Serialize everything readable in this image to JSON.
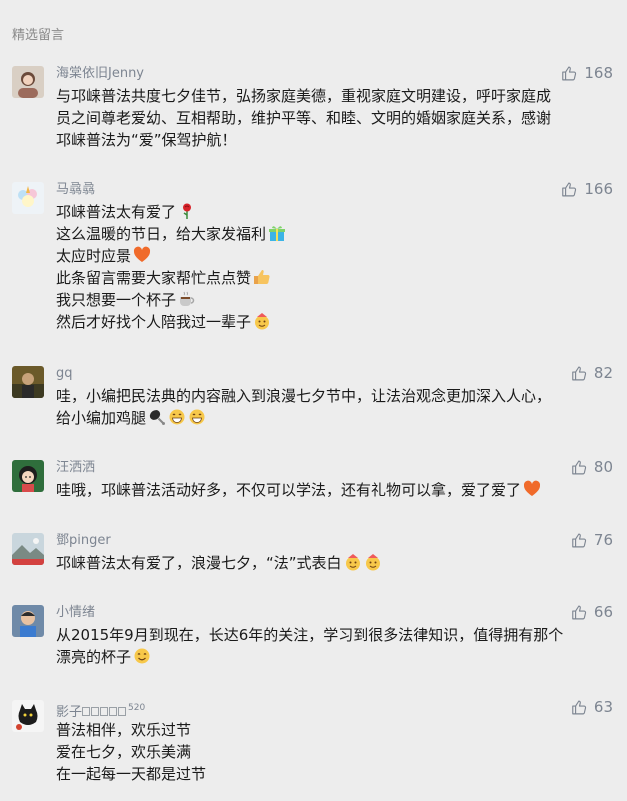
{
  "section_title": "精选留言",
  "comments": [
    {
      "nickname": "海棠依旧Jenny",
      "likes": "168",
      "lines": [
        "与邛崃普法共度七夕佳节，弘扬家庭美德，重视家庭文明建设，呼吁家庭成",
        "员之间尊老爱幼、互相帮助，维护平等、和睦、文明的婚姻家庭关系，感谢",
        "邛崃普法为“爱”保驾护航！"
      ],
      "avatar_icon": "woman-portrait-icon"
    },
    {
      "nickname": "马骉骉",
      "likes": "166",
      "lines": [
        "邛崃普法太有爱了",
        "这么温暖的节日，给大家发福利",
        "太应时应景",
        "此条留言需要大家帮忙点点赞",
        "我只想要一个杯子",
        "然后才好找个人陪我过一辈子"
      ],
      "line_emojis": [
        "rose-emoji",
        "gift-emoji",
        "heart-emoji",
        "thumbs-up-emoji",
        "coffee-emoji",
        "birthday-emoji"
      ],
      "avatar_icon": "unicorn-icon"
    },
    {
      "nickname": "gq",
      "likes": "82",
      "lines": [
        "哇，小编把民法典的内容融入到浪漫七夕节中，让法治观念更加深入人心，",
        "给小编加鸡腿"
      ],
      "line_emojis": [
        null,
        [
          "drumstick-emoji",
          "grin-emoji",
          "grin-emoji"
        ]
      ],
      "avatar_icon": "photo-portrait-icon"
    },
    {
      "nickname": "汪洒洒",
      "likes": "80",
      "lines": [
        "哇哦，邛崃普法活动好多，不仅可以学法，还有礼物可以拿，爱了爱了"
      ],
      "line_emojis": [
        "heart-emoji"
      ],
      "avatar_icon": "cartoon-girl-icon"
    },
    {
      "nickname": "鄧pinger",
      "likes": "76",
      "lines": [
        "邛崃普法太有爱了，浪漫七夕，“法”式表白"
      ],
      "line_emojis": [
        [
          "birthday-emoji",
          "birthday-emoji"
        ]
      ],
      "avatar_icon": "landscape-icon"
    },
    {
      "nickname": "小情绪",
      "likes": "66",
      "lines": [
        "从2015年9月到现在，长达6年的关注，学习到很多法律知识，值得拥有那个",
        "漂亮的杯子"
      ],
      "line_emojis": [
        null,
        "smile-emoji"
      ],
      "avatar_icon": "kid-portrait-icon"
    },
    {
      "nickname_main": "影子",
      "nickname_sup": "520",
      "likes": "63",
      "lines": [
        "普法相伴，欢乐过节",
        "爱在七夕，欢乐美满",
        "在一起每一天都是过节"
      ],
      "avatar_icon": "black-cat-icon"
    }
  ],
  "like_icon": "thumbs-up-outline-icon",
  "colors": {
    "background": "#ededed",
    "nickname": "#7d8591",
    "text": "#1a1a1a",
    "section_title": "#8a8a8a"
  }
}
